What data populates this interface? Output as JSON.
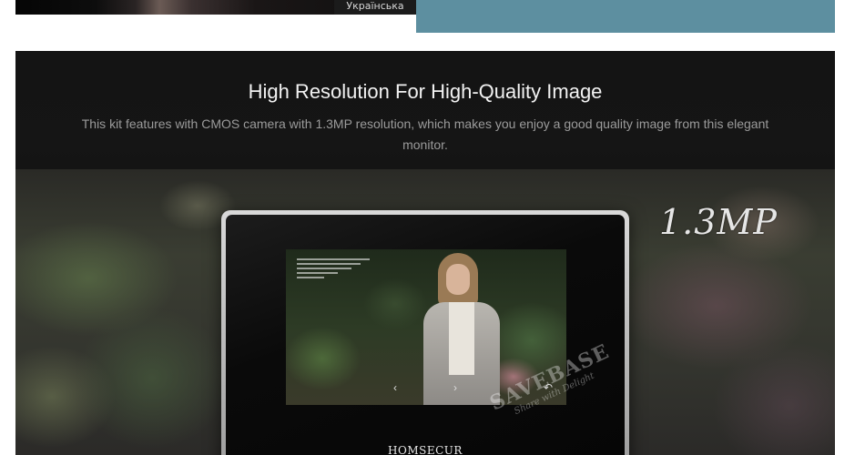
{
  "top_banner": {
    "language_label": "Українська"
  },
  "section": {
    "title": "High Resolution For High-Quality Image",
    "description": "This kit features with CMOS camera with 1.3MP resolution, which makes you enjoy a good quality image from this elegant monitor."
  },
  "product": {
    "brand": "HOMSECUR",
    "resolution_badge": "1.3MP",
    "watermark": "SAVEBASE",
    "watermark_tagline": "Share with Delight"
  },
  "icons": {
    "prev": "chevron-left-icon",
    "next": "chevron-right-icon",
    "back": "back-arrow-icon"
  },
  "colors": {
    "accent_strip": "#5d8fa0",
    "panel_bg": "#141414"
  }
}
